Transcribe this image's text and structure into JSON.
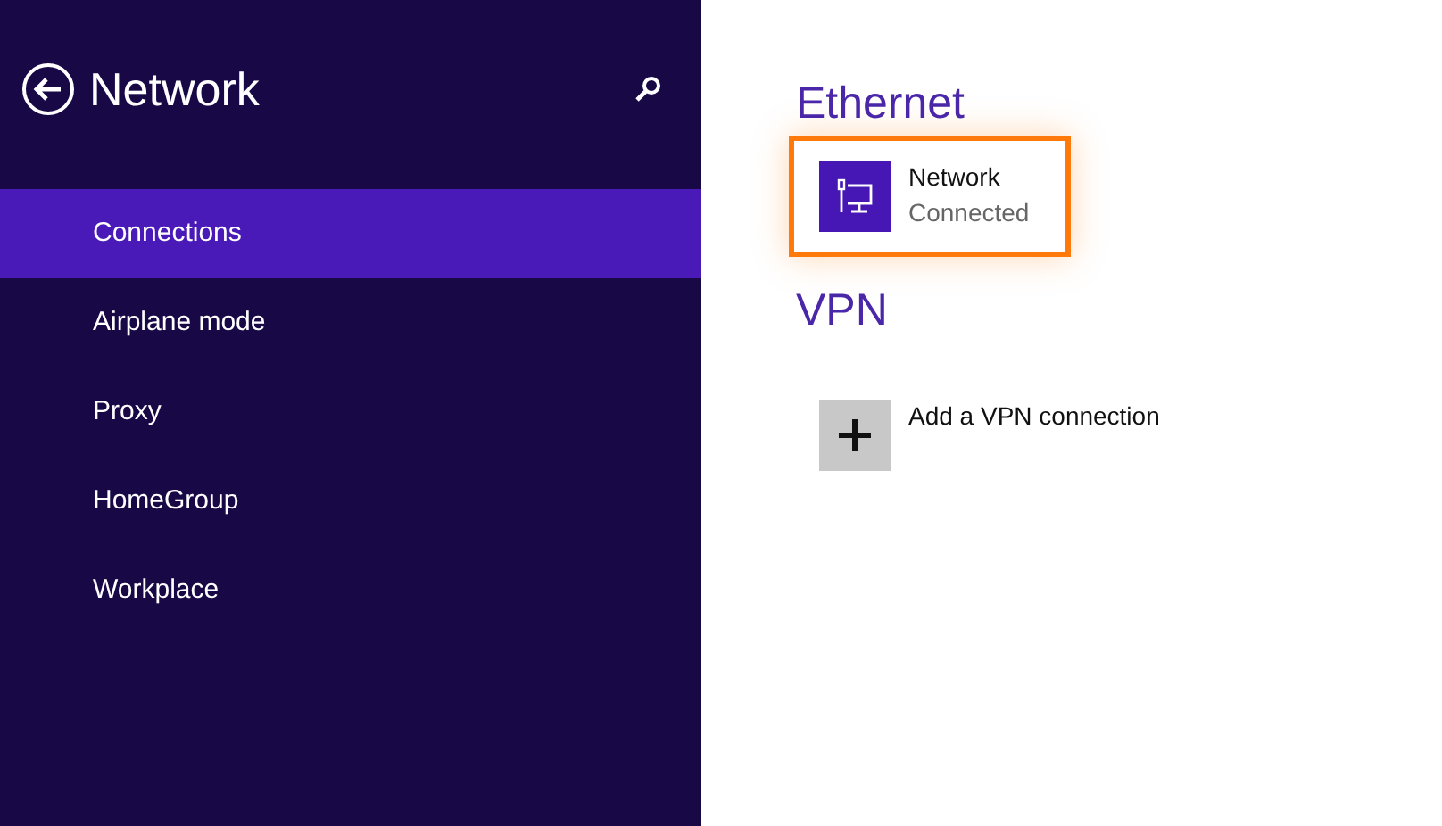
{
  "sidebar": {
    "title": "Network",
    "items": [
      {
        "label": "Connections",
        "selected": true
      },
      {
        "label": "Airplane mode",
        "selected": false
      },
      {
        "label": "Proxy",
        "selected": false
      },
      {
        "label": "HomeGroup",
        "selected": false
      },
      {
        "label": "Workplace",
        "selected": false
      }
    ]
  },
  "sections": [
    {
      "heading": "Ethernet",
      "items": [
        {
          "kind": "connection",
          "name": "Network",
          "status": "Connected",
          "highlighted": true
        }
      ]
    },
    {
      "heading": "VPN",
      "items": [
        {
          "kind": "add",
          "name": "Add a VPN connection",
          "highlighted": false
        }
      ]
    }
  ]
}
